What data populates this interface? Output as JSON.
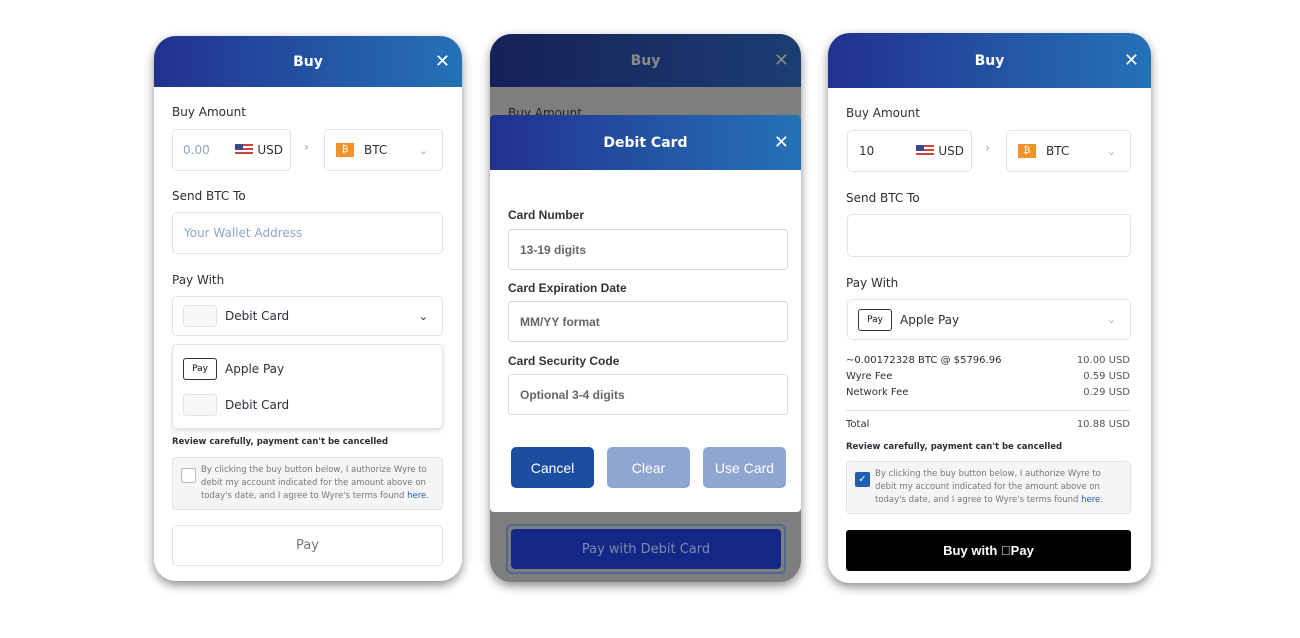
{
  "panel1": {
    "title": "Buy",
    "buy_amount_label": "Buy Amount",
    "amount_placeholder": "0.00",
    "fiat": "USD",
    "crypto": "BTC",
    "send_label": "Send BTC To",
    "wallet_placeholder": "Your Wallet Address",
    "pay_with_label": "Pay With",
    "pay_with_value": "Debit Card",
    "options": [
      "Apple Pay",
      "Debit Card"
    ],
    "review": "Review carefully, payment can't be cancelled",
    "terms": "By clicking the buy button below, I authorize Wyre to debit my account indicated for the amount above on today's date, and I agree to Wyre's terms found ",
    "terms_link": "here",
    "pay_button": "Pay"
  },
  "panel2": {
    "title": "Buy",
    "behind_label": "Buy Amount",
    "modal_title": "Debit Card",
    "fields": [
      {
        "label": "Card Number",
        "placeholder": "13-19 digits"
      },
      {
        "label": "Card Expiration Date",
        "placeholder": "MM/YY format"
      },
      {
        "label": "Card Security Code",
        "placeholder": "Optional 3-4 digits"
      }
    ],
    "cancel": "Cancel",
    "clear": "Clear",
    "use_card": "Use Card",
    "pay_button": "Pay with Debit Card"
  },
  "panel3": {
    "title": "Buy",
    "buy_amount_label": "Buy Amount",
    "amount": "10",
    "fiat": "USD",
    "crypto": "BTC",
    "send_label": "Send BTC To",
    "pay_with_label": "Pay With",
    "pay_with_value": "Apple Pay",
    "rows": [
      {
        "label": "~0.00172328 BTC @ $5796.96",
        "value": "10.00 USD"
      },
      {
        "label": "Wyre Fee",
        "value": "0.59 USD"
      },
      {
        "label": "Network Fee",
        "value": "0.29 USD"
      }
    ],
    "total_label": "Total",
    "total_value": "10.88 USD",
    "review": "Review carefully, payment can't be cancelled",
    "terms": "By clicking the buy button below, I authorize Wyre to debit my account indicated for the amount above on today's date, and I agree to Wyre's terms found ",
    "terms_link": "here",
    "pay_button": "Buy with Pay",
    "checked": true
  },
  "icons": {
    "close": "close-icon",
    "flag": "us-flag-icon",
    "btc": "bitcoin-icon",
    "card": "debit-card-icon",
    "apple_pay": "apple-pay-icon",
    "chevron": "chevron-down-icon"
  },
  "colors": {
    "header_start": "#22318f",
    "header_end": "#2472b6",
    "primary": "#1c4ea0",
    "disabled": "#8fa6d0",
    "apple_pay_button": "#000000"
  }
}
